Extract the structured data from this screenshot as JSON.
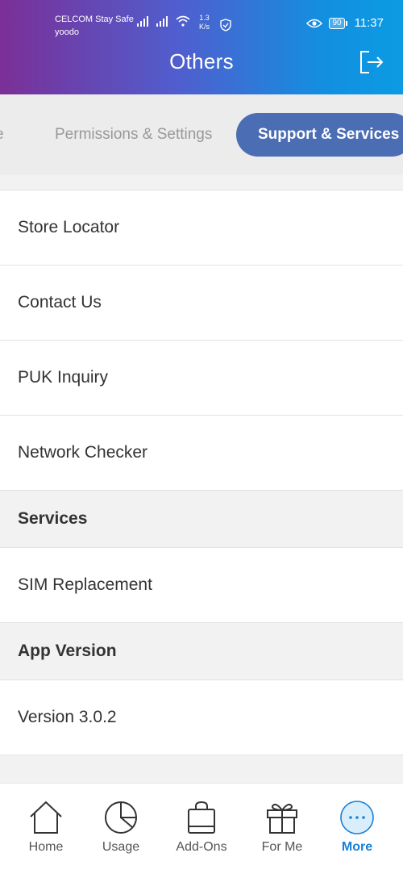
{
  "status_bar": {
    "carrier_line1": "CELCOM Stay Safe",
    "carrier_line2": "yoodo",
    "speed_value": "1.3",
    "speed_unit": "K/s",
    "battery": "90",
    "time": "11:37"
  },
  "header": {
    "title": "Others"
  },
  "tabs": {
    "cut_tab": "e",
    "permissions": "Permissions & Settings",
    "support": "Support & Services"
  },
  "list": {
    "support_items": [
      "Store Locator",
      "Contact Us",
      "PUK Inquiry",
      "Network Checker"
    ],
    "services_header": "Services",
    "services_items": [
      "SIM Replacement"
    ],
    "app_version_header": "App Version",
    "version": "Version 3.0.2"
  },
  "bottom_nav": {
    "items": [
      {
        "label": "Home",
        "icon": "home-icon"
      },
      {
        "label": "Usage",
        "icon": "pie-chart-icon"
      },
      {
        "label": "Add-Ons",
        "icon": "shopping-bag-icon"
      },
      {
        "label": "For Me",
        "icon": "gift-icon"
      },
      {
        "label": "More",
        "icon": "more-icon"
      }
    ],
    "active_color": "#1a7fd6"
  },
  "colors": {
    "header_gradient_start": "#7b2f97",
    "header_gradient_end": "#0b9be3",
    "active_tab": "#4a6db3"
  }
}
